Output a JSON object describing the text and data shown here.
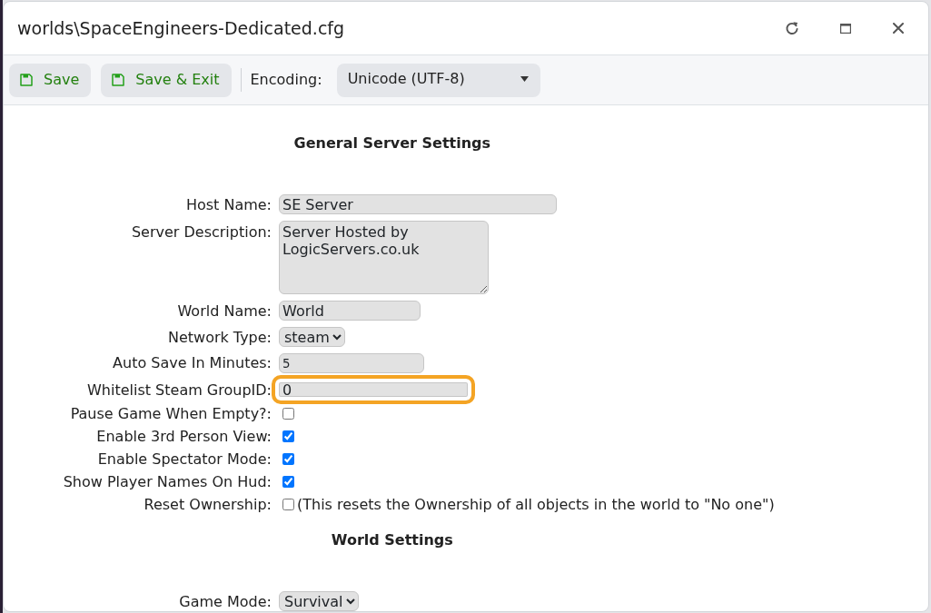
{
  "window": {
    "title": "worlds\\SpaceEngineers-Dedicated.cfg"
  },
  "toolbar": {
    "buttons": [
      {
        "label": "Save"
      },
      {
        "label": "Save & Exit"
      }
    ],
    "encoding_label": "Encoding:",
    "encoding_value": "Unicode (UTF-8)"
  },
  "sections": [
    {
      "title": "General Server Settings",
      "fields": [
        {
          "kind": "text",
          "label": "Host Name:",
          "value": "SE Server",
          "focused": false
        },
        {
          "kind": "textarea",
          "label": "Server Description:",
          "value": "Server Hosted by LogicServers.co.uk",
          "focused": false
        },
        {
          "kind": "text",
          "label": "World Name:",
          "value": "World",
          "focused": false
        },
        {
          "kind": "select",
          "label": "Network Type:",
          "value": "steam",
          "focused": false
        },
        {
          "kind": "number",
          "label": "Auto Save In Minutes:",
          "value": "5",
          "focused": false
        },
        {
          "kind": "text",
          "label": "Whitelist Steam GroupID:",
          "value": "0",
          "focused": true
        },
        {
          "kind": "checkbox",
          "label": "Pause Game When Empty?:",
          "checked": false
        },
        {
          "kind": "checkbox",
          "label": "Enable 3rd Person View:",
          "checked": true
        },
        {
          "kind": "checkbox",
          "label": "Enable Spectator Mode:",
          "checked": true
        },
        {
          "kind": "checkbox",
          "label": "Show Player Names On Hud:",
          "checked": true
        },
        {
          "kind": "checkbox",
          "label": "Reset Ownership:",
          "checked": false,
          "note": "(This resets the Ownership of all objects in the world to \"No one\")"
        }
      ]
    },
    {
      "title": "World Settings",
      "fields": [
        {
          "kind": "select",
          "label": "Game Mode:",
          "value": "Survival",
          "focused": false
        }
      ]
    }
  ]
}
